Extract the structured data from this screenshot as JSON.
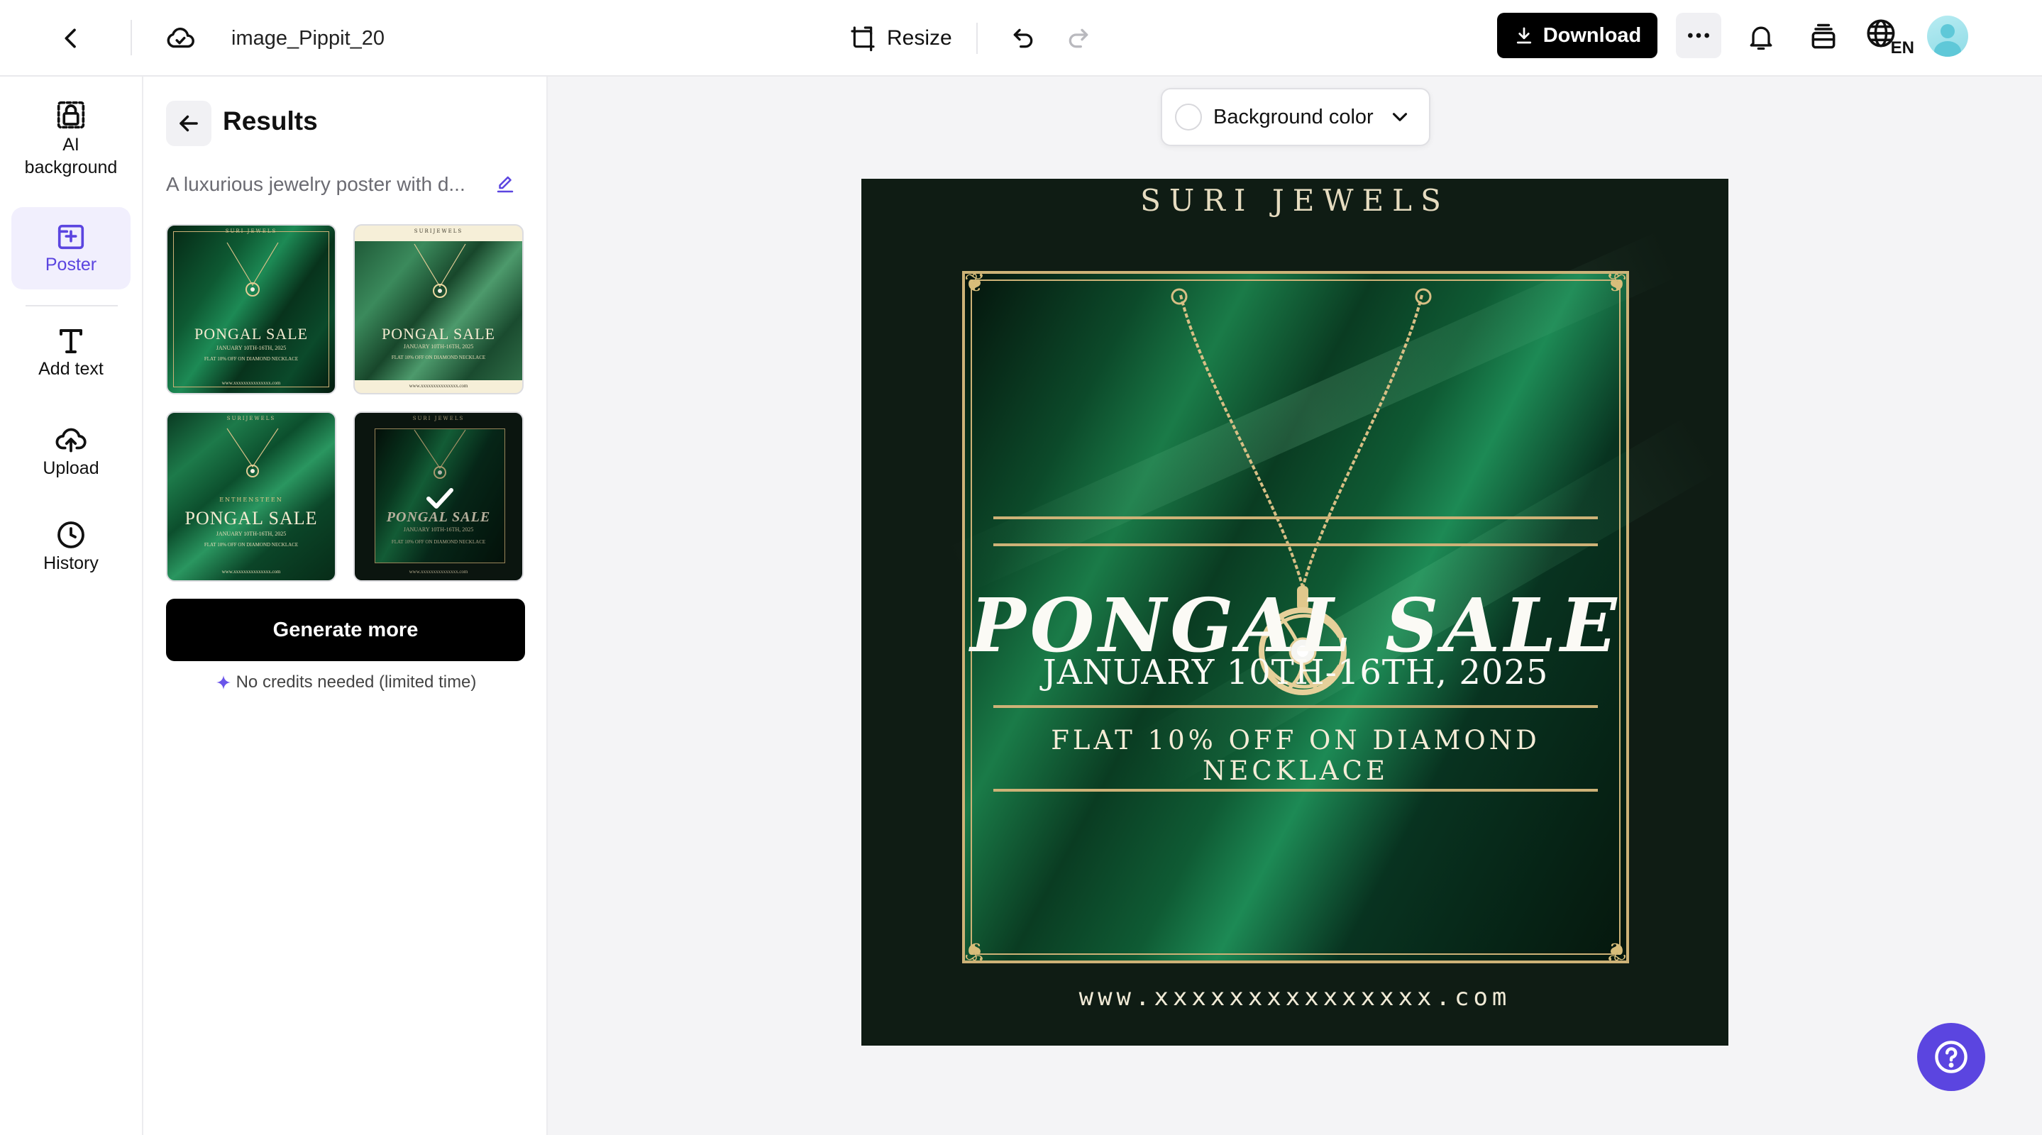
{
  "topbar": {
    "filename": "image_Pippit_20",
    "resize_label": "Resize",
    "download_label": "Download",
    "language": "EN"
  },
  "rail": {
    "items": [
      {
        "label": "AI\nbackground",
        "icon": "ai-background-icon"
      },
      {
        "label": "Poster",
        "icon": "poster-icon",
        "active": true
      },
      {
        "label": "Add text",
        "icon": "text-icon"
      },
      {
        "label": "Upload",
        "icon": "upload-cloud-icon"
      },
      {
        "label": "History",
        "icon": "clock-icon"
      }
    ]
  },
  "panel": {
    "title": "Results",
    "prompt": "A luxurious jewelry poster with d...",
    "generate_label": "Generate more",
    "credits_note": "No credits needed (limited time)",
    "thumbnails": [
      {
        "brand": "SURI JEWELS",
        "headline": "PONGAL SALE",
        "sub": "JANUARY 10TH-16TH, 2025",
        "offer": "FLAT 10% OFF ON DIAMOND NECKLACE",
        "url": "www.xxxxxxxxxxxxxxx.com"
      },
      {
        "brand": "SURIJEWELS",
        "headline": "PONGAL SALE",
        "sub": "JANUARY 10TH-16TH, 2025",
        "offer": "FLAT 10% OFF ON DIAMOND NECKLACE",
        "url": "www.xxxxxxxxxxxxxxx.com"
      },
      {
        "brand": "SURIJEWELS",
        "tag": "ENTHENSTEEN",
        "headline": "PONGAL SALE",
        "sub": "JANUARY 10TH-16TH, 2025",
        "offer": "FLAT 10% OFF ON DIAMOND NECKLACE",
        "url": "www.xxxxxxxxxxxxxxx.com"
      },
      {
        "brand": "SURI JEWELS",
        "headline": "PONGAL SALE",
        "sub": "JANUARY 10TH-16TH, 2025",
        "offer": "FLAT 10% OFF ON DIAMOND NECKLACE",
        "url": "www.xxxxxxxxxxxxxxx.com",
        "selected": true
      }
    ]
  },
  "canvas": {
    "background_color_label": "Background color",
    "poster": {
      "brand": "SURI JEWELS",
      "headline": "PONGAL SALE",
      "date": "JANUARY 10TH-16TH, 2025",
      "offer": "FLAT 10% OFF ON DIAMOND NECKLACE",
      "url": "www.xxxxxxxxxxxxxxx.com"
    }
  },
  "colors": {
    "accent": "#5b45e0",
    "poster_bg": "#0f1c14",
    "gold": "#cdb277"
  }
}
